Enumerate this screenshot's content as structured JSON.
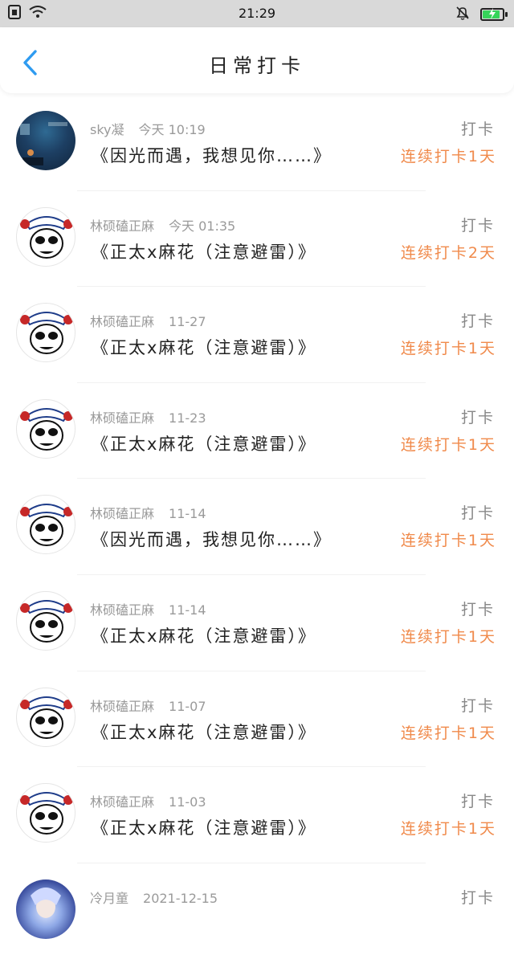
{
  "status_bar": {
    "time": "21:29"
  },
  "header": {
    "title": "日常打卡"
  },
  "items": [
    {
      "user": "sky凝",
      "time": "今天 10:19",
      "book": "《因光而遇，我想见你……》",
      "kind": "打卡",
      "streak": "连续打卡1天",
      "avatar": "sky"
    },
    {
      "user": "林硕磕正麻",
      "time": "今天 01:35",
      "book": "《正太x麻花（注意避雷）》",
      "kind": "打卡",
      "streak": "连续打卡2天",
      "avatar": "panda"
    },
    {
      "user": "林硕磕正麻",
      "time": "11-27",
      "book": "《正太x麻花（注意避雷）》",
      "kind": "打卡",
      "streak": "连续打卡1天",
      "avatar": "panda"
    },
    {
      "user": "林硕磕正麻",
      "time": "11-23",
      "book": "《正太x麻花（注意避雷）》",
      "kind": "打卡",
      "streak": "连续打卡1天",
      "avatar": "panda"
    },
    {
      "user": "林硕磕正麻",
      "time": "11-14",
      "book": "《因光而遇，我想见你……》",
      "kind": "打卡",
      "streak": "连续打卡1天",
      "avatar": "panda"
    },
    {
      "user": "林硕磕正麻",
      "time": "11-14",
      "book": "《正太x麻花（注意避雷）》",
      "kind": "打卡",
      "streak": "连续打卡1天",
      "avatar": "panda"
    },
    {
      "user": "林硕磕正麻",
      "time": "11-07",
      "book": "《正太x麻花（注意避雷）》",
      "kind": "打卡",
      "streak": "连续打卡1天",
      "avatar": "panda"
    },
    {
      "user": "林硕磕正麻",
      "time": "11-03",
      "book": "《正太x麻花（注意避雷）》",
      "kind": "打卡",
      "streak": "连续打卡1天",
      "avatar": "panda"
    },
    {
      "user": "冷月童",
      "time": "2021-12-15",
      "book": "",
      "kind": "打卡",
      "streak": "",
      "avatar": "moon"
    }
  ],
  "colors": {
    "accent": "#2e9bf0",
    "streak": "#f08a4b",
    "battery": "#36d45a"
  },
  "icons": {
    "status_left": [
      "sim-icon",
      "wifi-icon"
    ],
    "status_right": [
      "silent-bell-icon",
      "battery-charging-icon"
    ],
    "back": "back-arrow-icon"
  }
}
